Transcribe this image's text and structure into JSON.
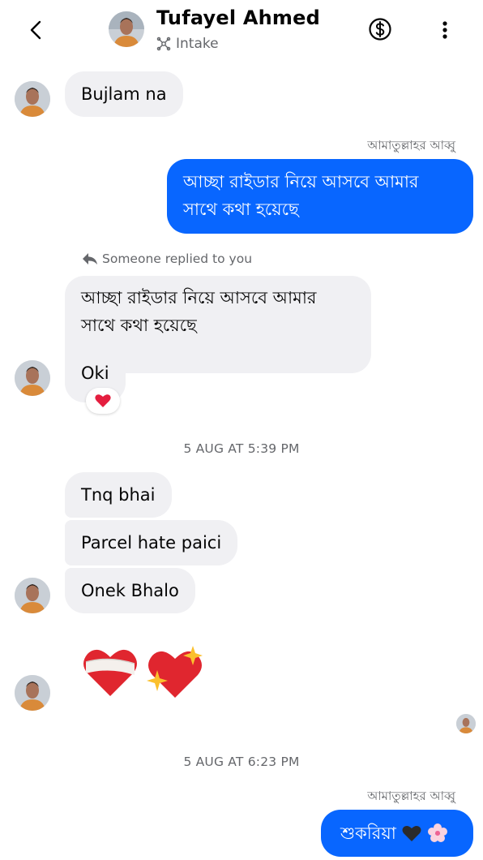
{
  "header": {
    "contact_name": "Tufayel Ahmed",
    "subtitle": "Intake"
  },
  "messages": {
    "m1": "Bujlam na",
    "sender_label_1": "আমাতুল্লাহর আব্বু",
    "m2_line1": "আচ্ছা রাইডার নিয়ে আসবে আমার",
    "m2_line2": "সাথে কথা হয়েছে",
    "reply_note": "Someone replied to you",
    "m3_quote_line1": "আচ্ছা রাইডার নিয়ে আসবে আমার",
    "m3_quote_line2": "সাথে কথা হয়েছে",
    "m3_reply": "Oki",
    "timestamp_1": "5 AUG AT 5:39 PM",
    "m4": "Tnq bhai",
    "m5": "Parcel hate paici",
    "m6": "Onek Bhalo",
    "timestamp_2": "5 AUG AT 6:23 PM",
    "sender_label_2": "আমাতুল্লাহর আব্বু",
    "m7": "শুকরিয়া"
  },
  "colors": {
    "outgoing_bubble": "#0866ff",
    "incoming_bubble": "#f0f0f3",
    "secondary_text": "#65676b"
  },
  "icons": [
    "back-chevron-icon",
    "avatar",
    "intake-icon",
    "dollar-icon",
    "more-vertical-icon",
    "reply-arrow-icon",
    "heart-reaction-icon",
    "bandaged-heart-emoji",
    "sparkling-heart-emoji",
    "black-heart-emoji",
    "cherry-blossom-emoji"
  ]
}
